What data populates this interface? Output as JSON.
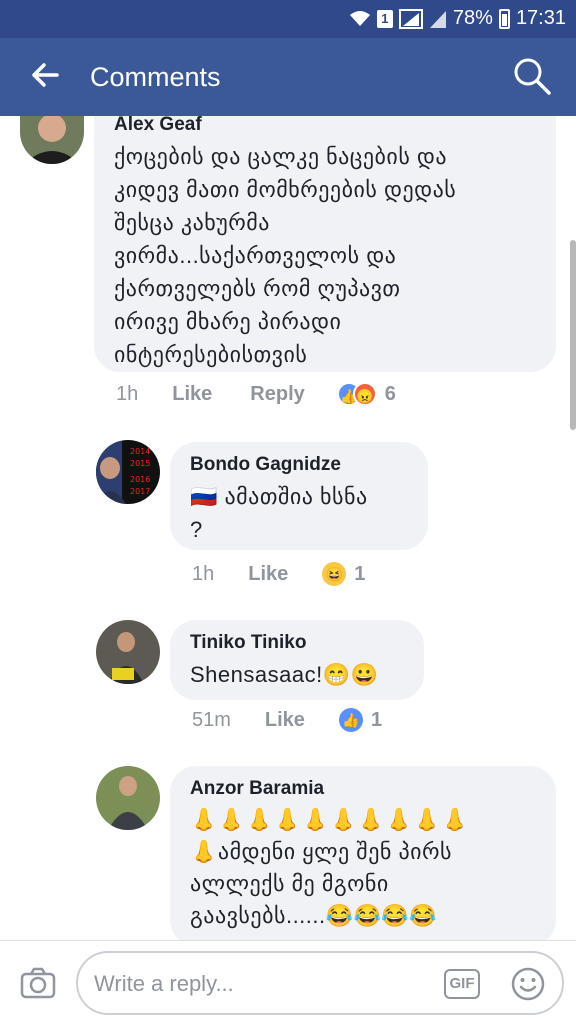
{
  "status_bar": {
    "sim": "1",
    "battery": "78%",
    "time": "17:31"
  },
  "app_bar": {
    "title": "Comments"
  },
  "comments": [
    {
      "author": "Alex Geaf",
      "text": "ქოცების და ცალკე ნაცების  და\nკიდევ მათი მომხრეების დედას\nშესცა კახურმა\nვირმა...საქართველოს და\nქართველებს რომ ღუპავთ\nირივე მხარე პირადი\nინტერესებისთვის",
      "time": "1h",
      "like": "Like",
      "reply": "Reply",
      "reactions": "6"
    },
    {
      "author": "Bondo Gagnidze",
      "text": "🇷🇺 ამათშია ხსნა\n?",
      "time": "1h",
      "like": "Like",
      "reactions": "1",
      "avatar_labels": [
        "2014",
        "2015",
        "2016",
        "2017"
      ]
    },
    {
      "author": "Tiniko Tiniko",
      "text": "Shensasaac!😁😀",
      "time": "51m",
      "like": "Like",
      "reactions": "1"
    },
    {
      "author": "Anzor Baramia",
      "text": "👃👃👃👃👃👃👃👃👃👃\n👃ამდენი ყლე შენ პირს\nალლექს მე მგონი\nგაავსებს......😂😂😂😂"
    }
  ],
  "composer": {
    "placeholder": "Write a reply...",
    "gif": "GIF"
  }
}
